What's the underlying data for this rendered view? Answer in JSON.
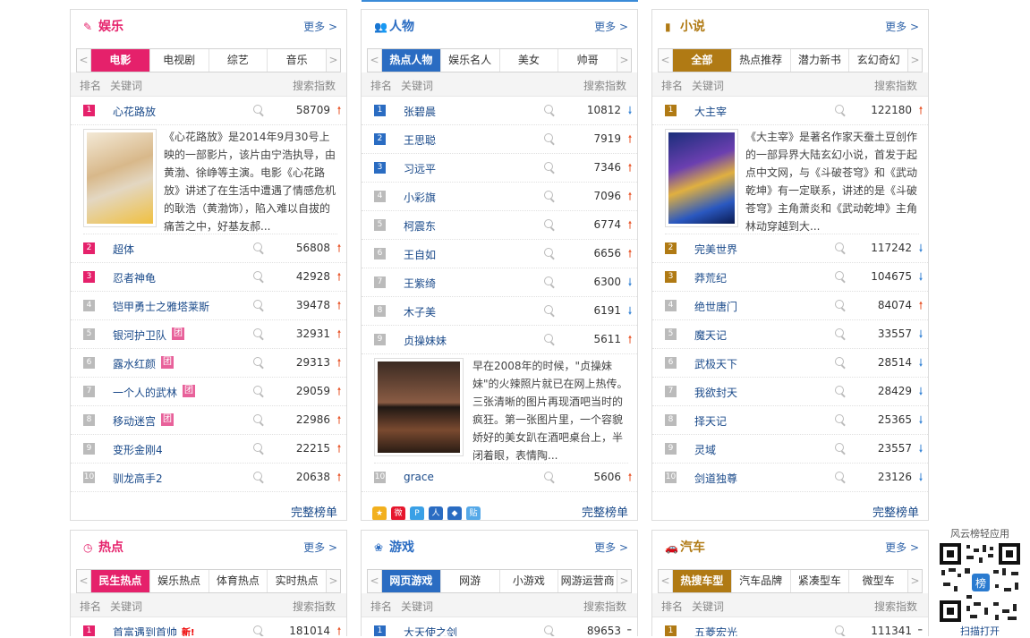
{
  "colors": {
    "yule": "#e5216b",
    "renwu": "#2a6cc2",
    "xiaoshuo": "#b07a14",
    "redian": "#e5216b",
    "youxi": "#2a6cc2",
    "qiche": "#b07a14"
  },
  "common": {
    "more": "更多 >",
    "col_rank": "排名",
    "col_kw": "关键词",
    "col_idx": "搜索指数",
    "full": "完整榜单",
    "left_arrow": "<",
    "right_arrow": ">"
  },
  "panels": [
    {
      "title": "娱乐",
      "icon": "microphone-icon",
      "tabs": [
        "电影",
        "电视剧",
        "综艺",
        "音乐"
      ],
      "rows": [
        {
          "rank": "1",
          "kw": "心花路放",
          "num": "58709",
          "trend": "up"
        },
        {
          "rank": "2",
          "kw": "超体",
          "num": "56808",
          "trend": "up"
        },
        {
          "rank": "3",
          "kw": "忍者神龟",
          "num": "42928",
          "trend": "up"
        },
        {
          "rank": "4",
          "kw": "铠甲勇士之雅塔莱斯",
          "num": "39478",
          "trend": "up"
        },
        {
          "rank": "5",
          "kw": "银河护卫队",
          "num": "32931",
          "trend": "up",
          "tag": "团"
        },
        {
          "rank": "6",
          "kw": "露水红颜",
          "num": "29313",
          "trend": "up",
          "tag": "团"
        },
        {
          "rank": "7",
          "kw": "一个人的武林",
          "num": "29059",
          "trend": "up",
          "tag": "团"
        },
        {
          "rank": "8",
          "kw": "移动迷宫",
          "num": "22986",
          "trend": "up",
          "tag": "团"
        },
        {
          "rank": "9",
          "kw": "变形金刚4",
          "num": "22215",
          "trend": "up"
        },
        {
          "rank": "10",
          "kw": "驯龙高手2",
          "num": "20638",
          "trend": "up"
        }
      ],
      "detail": "《心花路放》是2014年9月30号上映的一部影片，该片由宁浩执导，由黄渤、徐峥等主演。电影《心花路放》讲述了在生活中遭遇了情感危机的耿浩（黄渤饰），陷入难以自拔的痛苦之中，好基友郝..."
    },
    {
      "title": "人物",
      "icon": "people-icon",
      "tabs": [
        "热点人物",
        "娱乐名人",
        "美女",
        "帅哥"
      ],
      "rows": [
        {
          "rank": "1",
          "kw": "张碧晨",
          "num": "10812",
          "trend": "down"
        },
        {
          "rank": "2",
          "kw": "王思聪",
          "num": "7919",
          "trend": "up"
        },
        {
          "rank": "3",
          "kw": "习远平",
          "num": "7346",
          "trend": "up"
        },
        {
          "rank": "4",
          "kw": "小彩旗",
          "num": "7096",
          "trend": "up"
        },
        {
          "rank": "5",
          "kw": "柯震东",
          "num": "6774",
          "trend": "up"
        },
        {
          "rank": "6",
          "kw": "王自如",
          "num": "6656",
          "trend": "up"
        },
        {
          "rank": "7",
          "kw": "王紫绮",
          "num": "6300",
          "trend": "down"
        },
        {
          "rank": "8",
          "kw": "木子美",
          "num": "6191",
          "trend": "down"
        },
        {
          "rank": "9",
          "kw": "贞操妹妹",
          "num": "5611",
          "trend": "up"
        },
        {
          "rank": "10",
          "kw": "grace",
          "num": "5606",
          "trend": "up"
        }
      ],
      "detail": "早在2008年的时候，\"贞操妹妹\"的火辣照片就已在网上热传。三张清晰的图片再现酒吧当时的疯狂。第一张图片里，一个容貌娇好的美女趴在酒吧桌台上，半闭着眼，表情陶..."
    },
    {
      "title": "小说",
      "icon": "book-icon",
      "tabs": [
        "全部",
        "热点推荐",
        "潜力新书",
        "玄幻奇幻"
      ],
      "rows": [
        {
          "rank": "1",
          "kw": "大主宰",
          "num": "122180",
          "trend": "up"
        },
        {
          "rank": "2",
          "kw": "完美世界",
          "num": "117242",
          "trend": "down"
        },
        {
          "rank": "3",
          "kw": "莽荒纪",
          "num": "104675",
          "trend": "down"
        },
        {
          "rank": "4",
          "kw": "绝世唐门",
          "num": "84074",
          "trend": "up"
        },
        {
          "rank": "5",
          "kw": "魔天记",
          "num": "33557",
          "trend": "down"
        },
        {
          "rank": "6",
          "kw": "武极天下",
          "num": "28514",
          "trend": "down"
        },
        {
          "rank": "7",
          "kw": "我欲封天",
          "num": "28429",
          "trend": "down"
        },
        {
          "rank": "8",
          "kw": "择天记",
          "num": "25365",
          "trend": "down"
        },
        {
          "rank": "9",
          "kw": "灵域",
          "num": "23557",
          "trend": "down"
        },
        {
          "rank": "10",
          "kw": "剑道独尊",
          "num": "23126",
          "trend": "down"
        }
      ],
      "detail": "《大主宰》是著名作家天蚕土豆创作的一部异界大陆玄幻小说，首发于起点中文网，与《斗破苍穹》和《武动乾坤》有一定联系，讲述的是《斗破苍穹》主角萧炎和《武动乾坤》主角林动穿越到大..."
    },
    {
      "title": "热点",
      "icon": "clock-icon",
      "tabs": [
        "民生热点",
        "娱乐热点",
        "体育热点",
        "实时热点"
      ],
      "rows": [
        {
          "rank": "1",
          "kw": "首富遇到首帅",
          "num": "181014",
          "trend": "up",
          "new": "新!"
        }
      ]
    },
    {
      "title": "游戏",
      "icon": "gamepad-icon",
      "tabs": [
        "网页游戏",
        "网游",
        "小游戏",
        "网游运营商"
      ],
      "rows": [
        {
          "rank": "1",
          "kw": "大天使之剑",
          "num": "89653",
          "trend": "flat"
        }
      ]
    },
    {
      "title": "汽车",
      "icon": "car-icon",
      "tabs": [
        "热搜车型",
        "汽车品牌",
        "紧凑型车",
        "微型车"
      ],
      "rows": [
        {
          "rank": "1",
          "kw": "五菱宏光",
          "num": "111341",
          "trend": "flat"
        }
      ]
    }
  ],
  "trend_glyphs": {
    "up": "🠑",
    "down": "🠓",
    "flat": "–"
  },
  "qr": {
    "label": "风云榜轻应用",
    "footer": "扫描打开",
    "badge": "榜"
  }
}
